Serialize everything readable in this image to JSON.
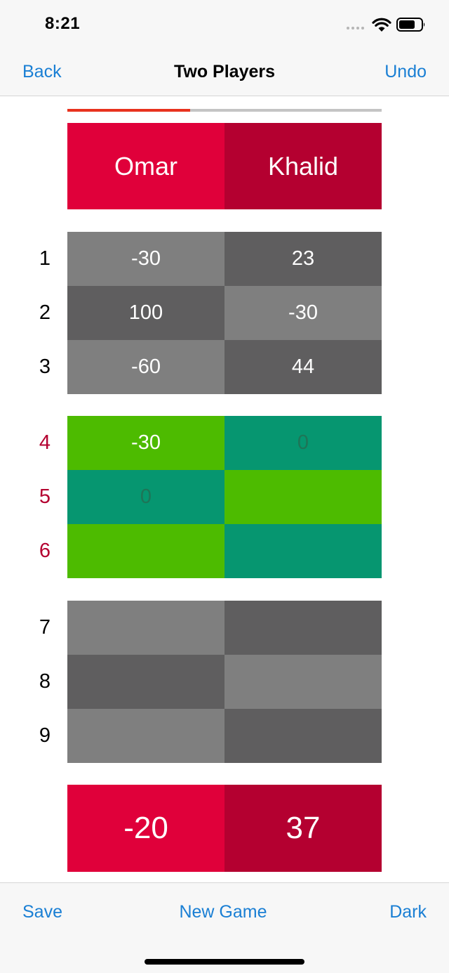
{
  "status": {
    "time": "8:21"
  },
  "nav": {
    "back": "Back",
    "title": "Two Players",
    "undo": "Undo"
  },
  "progress": {
    "fraction": 0.39
  },
  "players": [
    "Omar",
    "Khalid"
  ],
  "rounds": [
    {
      "num": "1",
      "special": false,
      "scores": [
        "-30",
        "23"
      ]
    },
    {
      "num": "2",
      "special": false,
      "scores": [
        "100",
        "-30"
      ]
    },
    {
      "num": "3",
      "special": false,
      "scores": [
        "-60",
        "44"
      ]
    },
    {
      "num": "4",
      "special": true,
      "scores": [
        "-30",
        "0"
      ]
    },
    {
      "num": "5",
      "special": true,
      "scores": [
        "0",
        ""
      ]
    },
    {
      "num": "6",
      "special": true,
      "scores": [
        "",
        ""
      ]
    },
    {
      "num": "7",
      "special": false,
      "scores": [
        "",
        ""
      ]
    },
    {
      "num": "8",
      "special": false,
      "scores": [
        "",
        ""
      ]
    },
    {
      "num": "9",
      "special": false,
      "scores": [
        "",
        ""
      ]
    }
  ],
  "totals": [
    "-20",
    "37"
  ],
  "toolbar": {
    "save": "Save",
    "new_game": "New Game",
    "dark": "Dark"
  },
  "colors": {
    "accent": "#1a7fd4",
    "progress": "#e8321e",
    "player_a": "#e0003a",
    "player_b": "#b40030",
    "grey_light": "#7f7f7f",
    "grey_dark": "#5f5e5f",
    "green_light": "#4dbb00",
    "green_dark": "#069670",
    "special_round": "#b40030"
  }
}
